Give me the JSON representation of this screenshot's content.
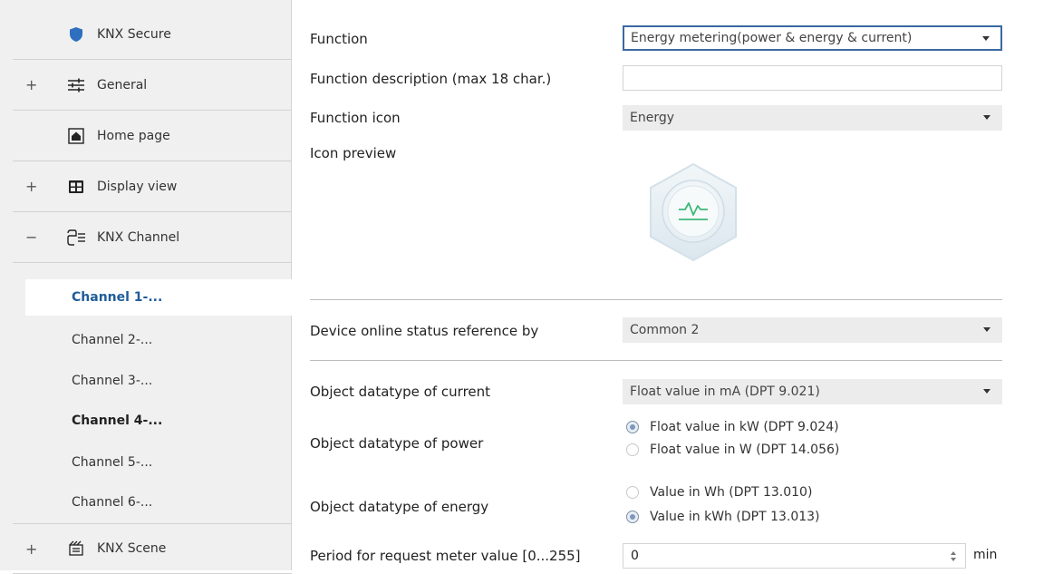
{
  "sidebar": {
    "items": [
      {
        "expander": "",
        "icon": "shield-icon",
        "label": "KNX Secure"
      },
      {
        "expander": "+",
        "icon": "sliders-icon",
        "label": "General"
      },
      {
        "expander": "",
        "icon": "home-icon",
        "label": "Home page"
      },
      {
        "expander": "+",
        "icon": "display-icon",
        "label": "Display view"
      },
      {
        "expander": "−",
        "icon": "knx-channel-icon",
        "label": "KNX Channel"
      }
    ],
    "channels": [
      {
        "label": "Channel 1-...",
        "state": "active"
      },
      {
        "label": "Channel 2-...",
        "state": "normal"
      },
      {
        "label": "Channel 3-...",
        "state": "normal"
      },
      {
        "label": "Channel 4-...",
        "state": "bold"
      },
      {
        "label": "Channel 5-...",
        "state": "normal"
      },
      {
        "label": "Channel 6-...",
        "state": "normal"
      }
    ],
    "scene": {
      "expander": "+",
      "icon": "scene-icon",
      "label": "KNX Scene"
    }
  },
  "form": {
    "function_label": "Function",
    "function_value": "Energy metering(power & energy & current)",
    "description_label": "Function description (max 18 char.)",
    "description_value": "",
    "icon_label": "Function icon",
    "icon_value": "Energy",
    "preview_label": "Icon preview",
    "preview_icon": "energy-pulse-icon",
    "online_label": "Device online status reference by",
    "online_value": "Common 2",
    "current_label": "Object datatype of current",
    "current_value": "Float value in mA (DPT 9.021)",
    "power_label": "Object datatype of power",
    "power_options": [
      {
        "label": "Float value in kW (DPT 9.024)",
        "selected": true
      },
      {
        "label": "Float value in W (DPT 14.056)",
        "selected": false
      }
    ],
    "energy_label": "Object datatype of energy",
    "energy_options": [
      {
        "label": "Value in Wh (DPT 13.010)",
        "selected": false
      },
      {
        "label": "Value in kWh (DPT 13.013)",
        "selected": true
      }
    ],
    "period_label": "Period for request meter value [0...255]",
    "period_value": "0",
    "period_unit": "min"
  },
  "colors": {
    "accent": "#1f5c99",
    "shield": "#2f6fc0",
    "energy": "#3cb97a"
  }
}
